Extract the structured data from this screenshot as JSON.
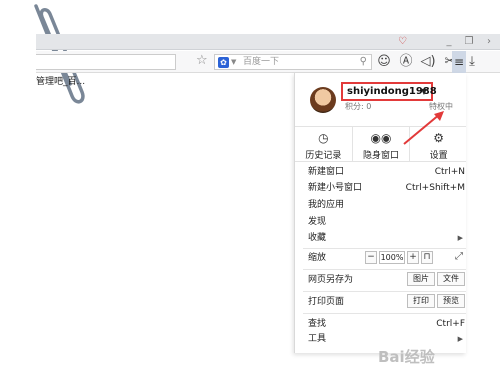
{
  "tab": {
    "title": "管理吧_百..."
  },
  "search": {
    "placeholder": "百度一下"
  },
  "user": {
    "name": "shiyindong1988",
    "points": "积分: 0",
    "privilege": "特权中"
  },
  "quick": [
    {
      "icon": "history-icon",
      "label": "历史记录"
    },
    {
      "icon": "incognito-icon",
      "label": "隐身窗口"
    },
    {
      "icon": "gear-icon",
      "label": "设置"
    }
  ],
  "menu": {
    "new_window": {
      "label": "新建窗口",
      "shortcut": "Ctrl+N"
    },
    "new_alt_window": {
      "label": "新建小号窗口",
      "shortcut": "Ctrl+Shift+M"
    },
    "my_apps": {
      "label": "我的应用"
    },
    "discover": {
      "label": "发现"
    },
    "favorites": {
      "label": "收藏"
    },
    "zoom": {
      "label": "缩放",
      "minus": "−",
      "value": "100%",
      "plus": "+"
    },
    "save_as": {
      "label": "网页另存为",
      "image": "图片",
      "file": "文件"
    },
    "print": {
      "label": "打印页面",
      "print": "打印",
      "preview": "预览"
    },
    "find": {
      "label": "查找",
      "shortcut": "Ctrl+F"
    },
    "tools": {
      "label": "工具"
    }
  },
  "watermark": "Bai经验",
  "colors": {
    "highlight": "#e23a3a"
  }
}
